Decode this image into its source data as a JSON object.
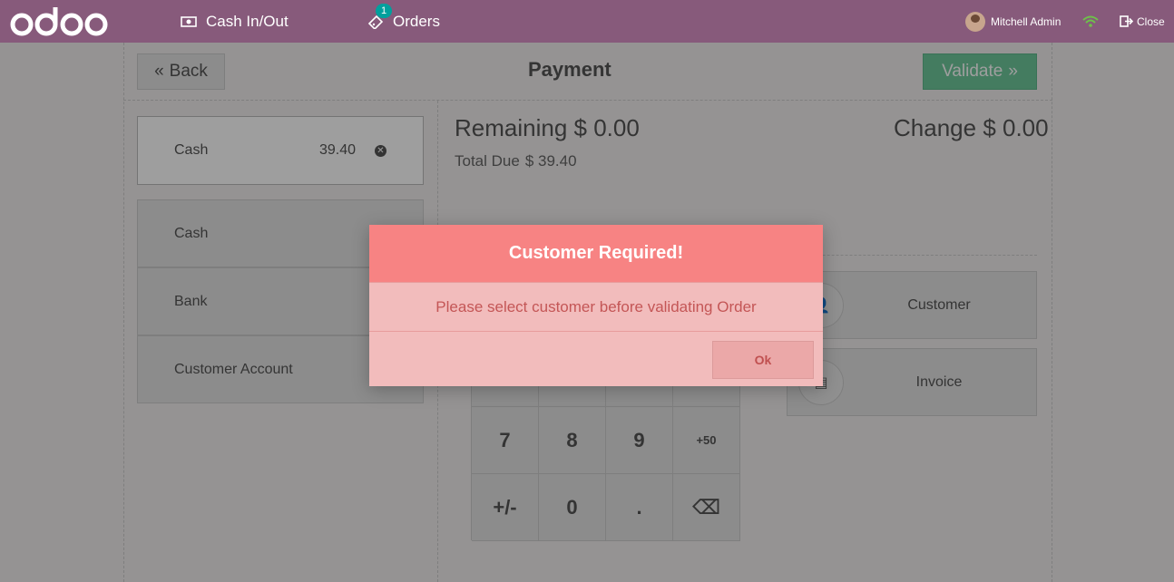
{
  "navbar": {
    "logo": "odoo",
    "cash_in_out": "Cash In/Out",
    "orders": "Orders",
    "orders_badge": "1",
    "user_name": "Mitchell Admin",
    "close": "Close",
    "brand_color": "#875a7b"
  },
  "payment": {
    "back": "Back",
    "title": "Payment",
    "validate": "Validate",
    "paymentline": {
      "method": "Cash",
      "amount": "39.40"
    },
    "methods": [
      "Cash",
      "Bank",
      "Customer Account"
    ],
    "remaining_label": "Remaining",
    "remaining_value": "$ 0.00",
    "change_label": "Change",
    "change_value": "$ 0.00",
    "total_due_label": "Total Due",
    "total_due_value": "$ 39.40",
    "customer_button": "Customer",
    "invoice_button": "Invoice",
    "numpad": [
      "7",
      "8",
      "9",
      "+50",
      "+/-",
      "0",
      ".",
      "⌫"
    ]
  },
  "modal": {
    "title": "Customer Required!",
    "message": "Please select customer before validating Order",
    "ok": "Ok"
  }
}
